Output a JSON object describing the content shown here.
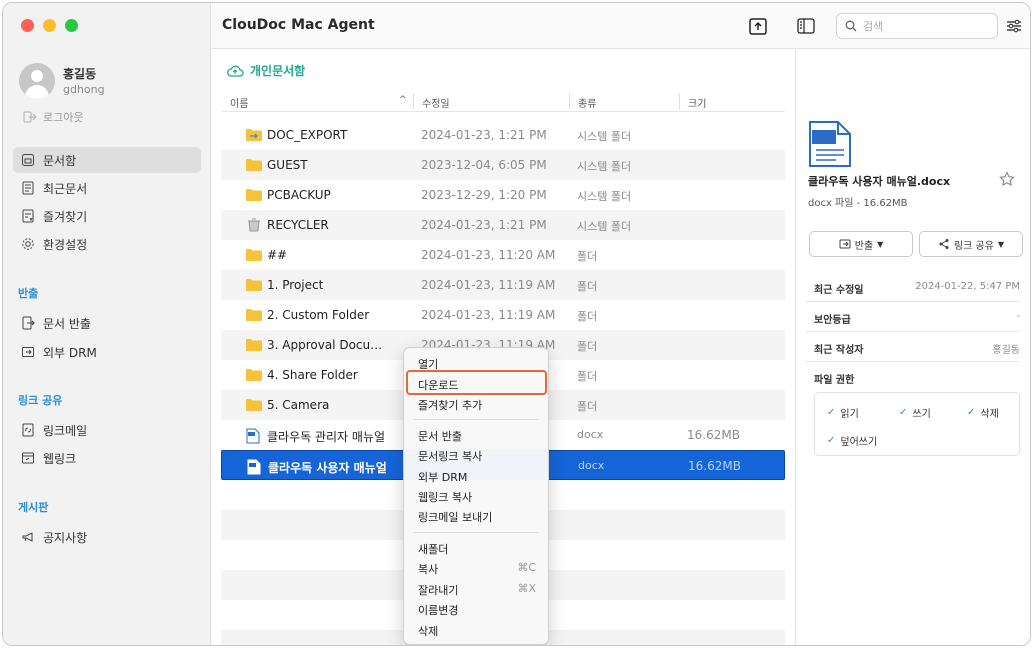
{
  "window": {
    "traffic_colors": [
      "#fe5f57",
      "#febc2e",
      "#28c840"
    ]
  },
  "toolbar": {
    "app_title": "ClouDoc Mac Agent",
    "search_placeholder": "검색"
  },
  "user": {
    "name": "홍길동",
    "id": "gdhong",
    "logout_label": "로그아웃"
  },
  "sidebar": {
    "items": [
      {
        "label": "문서함",
        "icon": "document-box-icon",
        "active": true
      },
      {
        "label": "최근문서",
        "icon": "recent-docs-icon"
      },
      {
        "label": "즐겨찾기",
        "icon": "favorites-icon"
      },
      {
        "label": "환경설정",
        "icon": "gear-icon"
      }
    ],
    "export_title": "반출",
    "export_items": [
      {
        "label": "문서 반출"
      },
      {
        "label": "외부 DRM"
      }
    ],
    "link_title": "링크 공유",
    "link_items": [
      {
        "label": "링크메일"
      },
      {
        "label": "웹링크"
      }
    ],
    "board_title": "게시판",
    "board_items": [
      {
        "label": "공지사항"
      }
    ]
  },
  "main": {
    "breadcrumb": "개인문서함",
    "columns": {
      "name": "이름",
      "modified": "수정일",
      "kind": "종류",
      "size": "크기"
    },
    "rows": [
      {
        "name": "DOC_EXPORT",
        "modified": "2024-01-23, 1:21 PM",
        "kind": "시스템 폴더",
        "size": "",
        "icon": "export-folder-icon"
      },
      {
        "name": "GUEST",
        "modified": "2023-12-04, 6:05 PM",
        "kind": "시스템 폴더",
        "size": "",
        "icon": "folder-icon"
      },
      {
        "name": "PCBACKUP",
        "modified": "2023-12-29, 1:20 PM",
        "kind": "시스템 폴더",
        "size": "",
        "icon": "folder-icon"
      },
      {
        "name": "RECYCLER",
        "modified": "2024-01-23, 1:21 PM",
        "kind": "시스템 폴더",
        "size": "",
        "icon": "trash-icon"
      },
      {
        "name": "##",
        "modified": "2024-01-23, 11:20 AM",
        "kind": "폴더",
        "size": "",
        "icon": "folder-icon"
      },
      {
        "name": "1. Project",
        "modified": "2024-01-23, 11:19 AM",
        "kind": "폴더",
        "size": "",
        "icon": "folder-icon"
      },
      {
        "name": "2. Custom Folder",
        "modified": "2024-01-23, 11:19 AM",
        "kind": "폴더",
        "size": "",
        "icon": "folder-icon"
      },
      {
        "name": "3. Approval Docu…",
        "modified": "2024-01-23, 11:19 AM",
        "kind": "폴더",
        "size": "",
        "icon": "folder-icon"
      },
      {
        "name": "4. Share Folder",
        "modified": "",
        "kind": "폴더",
        "size": "",
        "icon": "folder-icon"
      },
      {
        "name": "5. Camera",
        "modified": "",
        "kind": "폴더",
        "size": "",
        "icon": "folder-icon"
      },
      {
        "name": "클라우독 관리자 매뉴얼",
        "modified": "",
        "kind": "docx",
        "size": "16.62MB",
        "icon": "docx-file-icon"
      },
      {
        "name": "클라우독 사용자 매뉴얼",
        "modified": "",
        "kind": "docx",
        "size": "16.62MB",
        "icon": "docx-file-icon",
        "selected": true
      }
    ]
  },
  "context_menu": {
    "group1": [
      "열기",
      "다운로드",
      "즐겨찾기 추가"
    ],
    "highlighted": "다운로드",
    "group2": [
      "문서 반출",
      "문서링크 복사",
      "외부 DRM",
      "웹링크 복사",
      "링크메일 보내기"
    ],
    "group3": [
      {
        "label": "새폴더",
        "shortcut": ""
      },
      {
        "label": "복사",
        "shortcut": "⌘C"
      },
      {
        "label": "잘라내기",
        "shortcut": "⌘X"
      },
      {
        "label": "이름변경",
        "shortcut": ""
      },
      {
        "label": "삭제",
        "shortcut": ""
      }
    ]
  },
  "panel": {
    "file_name": "클라우독 사용자 매뉴얼.docx",
    "file_meta": "docx 파일 - 16.62MB",
    "export_button": "반출",
    "share_button": "링크 공유",
    "props": [
      {
        "key": "최근 수정일",
        "value": "2024-01-22, 5:47 PM"
      },
      {
        "key": "보안등급",
        "value": "-"
      },
      {
        "key": "최근 작성자",
        "value": "홍길동"
      }
    ],
    "permissions_title": "파일 권한",
    "permissions": [
      "읽기",
      "쓰기",
      "삭제",
      "덮어쓰기"
    ],
    "accent_color": "#2b8fd6"
  }
}
